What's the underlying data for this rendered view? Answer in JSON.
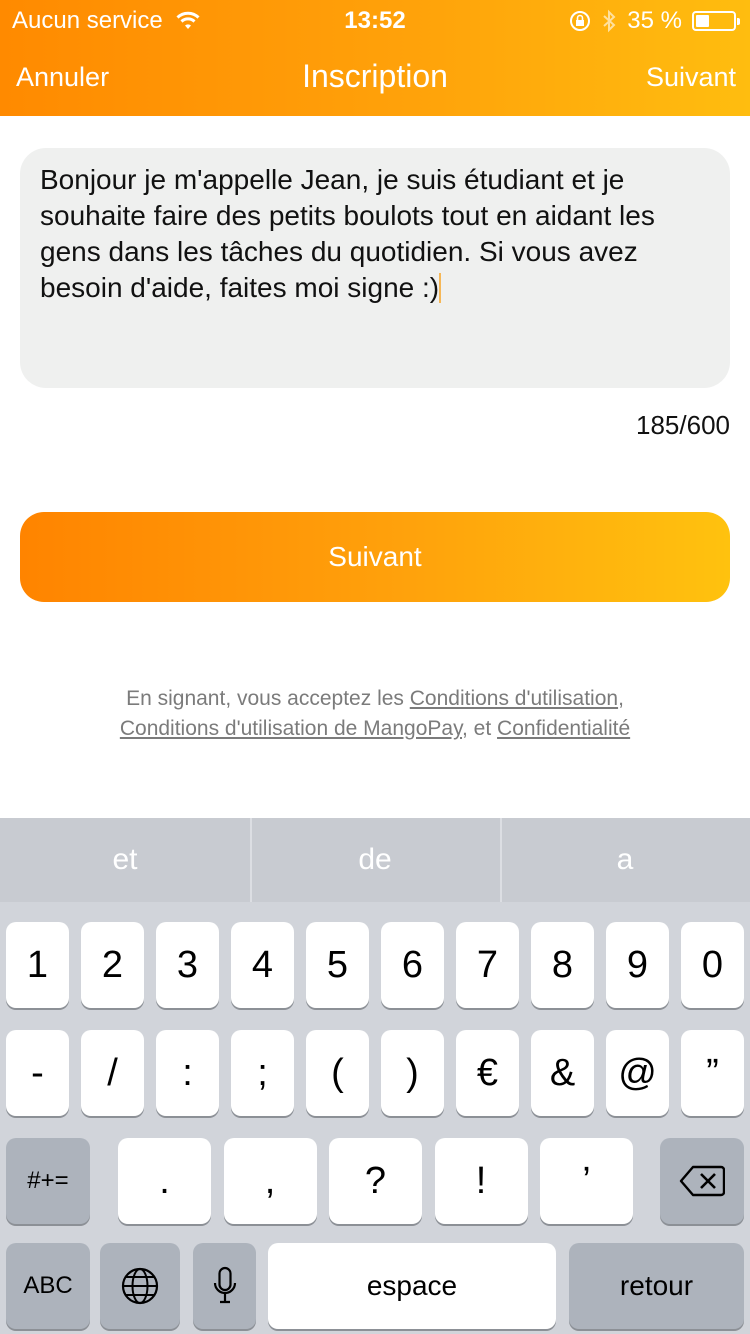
{
  "status_bar": {
    "carrier": "Aucun service",
    "time": "13:52",
    "battery_percent_label": "35 %",
    "battery_level": 0.35,
    "icons": [
      "wifi-icon",
      "rotation-lock-icon",
      "bluetooth-icon",
      "battery-icon"
    ]
  },
  "nav": {
    "cancel_label": "Annuler",
    "title": "Inscription",
    "next_label": "Suivant"
  },
  "bio": {
    "text": "Bonjour je m'appelle Jean, je suis étudiant et je souhaite faire des petits boulots tout en aidant les gens dans les tâches du quotidien. Si vous avez besoin d'aide, faites moi signe :)",
    "counter": "185/600"
  },
  "primary_button_label": "Suivant",
  "legal": {
    "prefix": "En signant, vous acceptez les ",
    "terms_link": "Conditions d'utilisation",
    "sep1": ",",
    "mangopay_link": "Conditions d'utilisation de MangoPay",
    "sep2": ", et ",
    "privacy_link": "Confidentialité"
  },
  "keyboard": {
    "suggestions": [
      "et",
      "de",
      "a"
    ],
    "row1": [
      "1",
      "2",
      "3",
      "4",
      "5",
      "6",
      "7",
      "8",
      "9",
      "0"
    ],
    "row2": [
      "-",
      "/",
      ":",
      ";",
      "(",
      ")",
      "€",
      "&",
      "@",
      "”"
    ],
    "row3": [
      ".",
      ",",
      "?",
      "!",
      "’"
    ],
    "symbols_label": "#+=",
    "abc_label": "ABC",
    "space_label": "espace",
    "return_label": "retour"
  },
  "colors": {
    "accent_start": "#ff8a00",
    "accent_end": "#ffbd0f"
  }
}
